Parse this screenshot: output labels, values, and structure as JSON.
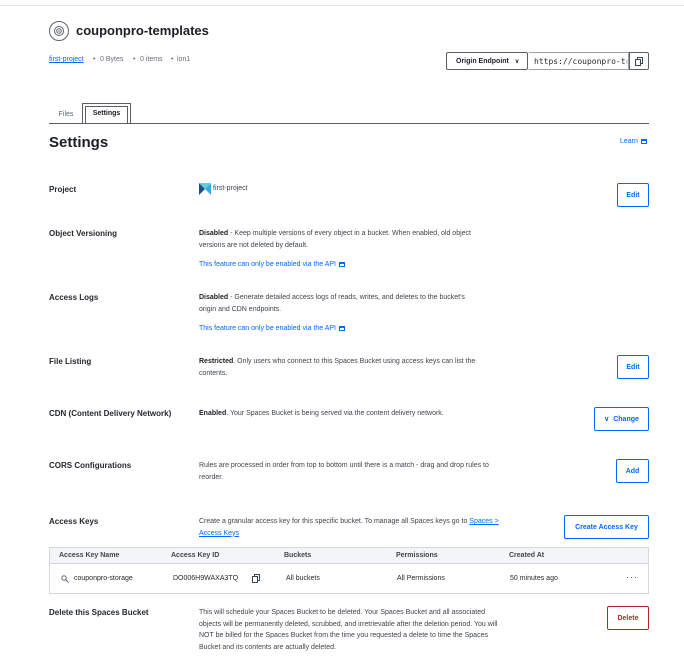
{
  "header": {
    "bucket_name": "couponpro-templates",
    "project_link": "first-project",
    "size": "0 Bytes",
    "items": "0 items",
    "region": "lon1",
    "endpoint_select": "Origin Endpoint",
    "endpoint_value": "https://couponpro-t",
    "endpoint_fade": "e"
  },
  "tabs": [
    {
      "label": "Files"
    },
    {
      "label": "Settings"
    }
  ],
  "page": {
    "title": "Settings",
    "learn": "Learn"
  },
  "sections": {
    "project": {
      "label": "Project",
      "value": "first-project",
      "button": "Edit"
    },
    "versioning": {
      "label": "Object Versioning",
      "status": "Disabled",
      "desc": " - Keep multiple versions of every object in a bucket. When enabled, old object versions are not deleted by default.",
      "link": "This feature can only be enabled via the API"
    },
    "access_logs": {
      "label": "Access Logs",
      "status": "Disabled",
      "desc": " - Generate detailed access logs of reads, writes, and deletes to the bucket's origin and CDN endpoints.",
      "link": "This feature can only be enabled via the API"
    },
    "file_listing": {
      "label": "File Listing",
      "status": "Restricted",
      "desc": ". Only users who connect to this Spaces Bucket using access keys can list the contents.",
      "button": "Edit"
    },
    "cdn": {
      "label": "CDN (Content Delivery Network)",
      "status": "Enabled",
      "desc": ". Your Spaces Bucket is being served via the content delivery network.",
      "button": "Change"
    },
    "cors": {
      "label": "CORS Configurations",
      "desc": "Rules are processed in order from top to bottom until there is a match - drag and drop rules to reorder.",
      "button": "Add"
    },
    "access_keys": {
      "label": "Access Keys",
      "desc": "Create a granular access key for this specific bucket. To manage all Spaces keys go to ",
      "desc_link": "Spaces > Access Keys",
      "button": "Create Access Key",
      "columns": [
        "Access Key Name",
        "Access Key ID",
        "Buckets",
        "Permissions",
        "Created At"
      ],
      "rows": [
        {
          "name": "couponpro-storage",
          "id": "DO006H9WAXA3TQ",
          "buckets": "All buckets",
          "permissions": "All Permissions",
          "created": "50 minutes ago",
          "more": "···"
        }
      ]
    },
    "delete": {
      "label": "Delete this Spaces Bucket",
      "desc": "This will schedule your Spaces Bucket to be deleted. Your Spaces Bucket and all associated objects will be permanently deleted, scrubbed, and irretrievable after the deletion period. You will NOT be billed for the Spaces Bucket from the time you requested a delete to time the Spaces Bucket and its contents are actually deleted.",
      "button": "Delete"
    }
  }
}
